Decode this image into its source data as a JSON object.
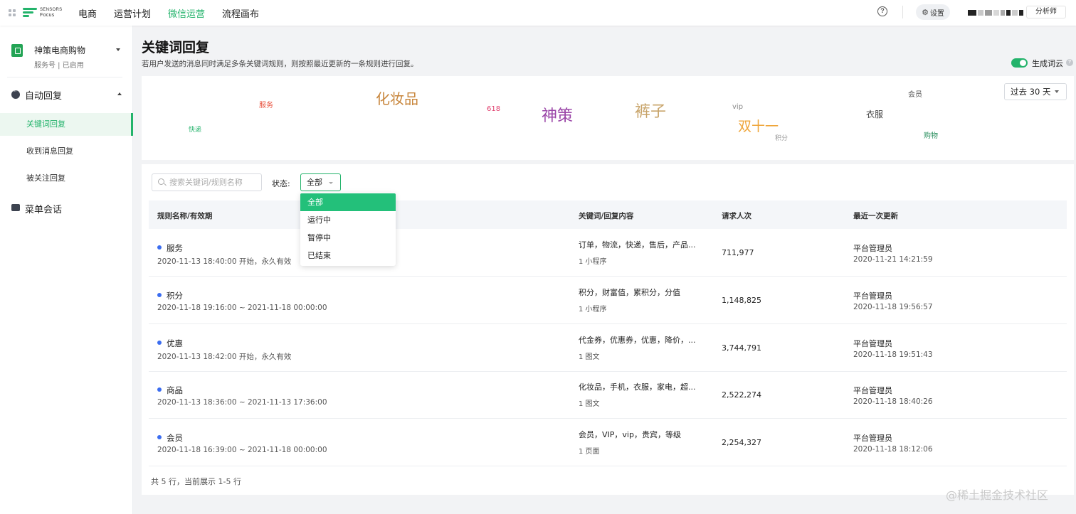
{
  "topnav": {
    "logo_line1": "SENSORS",
    "logo_line2": "Focus",
    "items": [
      {
        "label": "电商",
        "active": false
      },
      {
        "label": "运营计划",
        "active": false
      },
      {
        "label": "微信运营",
        "active": true
      },
      {
        "label": "流程画布",
        "active": false
      }
    ],
    "help": "?",
    "settings_label": "设置",
    "role_label": "分析师"
  },
  "sidebar": {
    "account_name": "神策电商购物",
    "account_sub": "服务号 | 已启用",
    "group_label": "自动回复",
    "sub_items": [
      {
        "label": "关键词回复",
        "active": true
      },
      {
        "label": "收到消息回复",
        "active": false
      },
      {
        "label": "被关注回复",
        "active": false
      }
    ],
    "menu2_label": "菜单会话"
  },
  "header": {
    "title": "关键词回复",
    "description": "若用户发送的消息同时满足多条关键词规则，则按照最近更新的一条规则进行回复。",
    "toggle_label": "生成词云",
    "toggle_on": true
  },
  "wordcloud": {
    "period": "过去 30 天",
    "words": [
      {
        "text": "服务",
        "color": "#e8503c"
      },
      {
        "text": "化妆品",
        "color": "#c8863c"
      },
      {
        "text": "618",
        "color": "#e0406e"
      },
      {
        "text": "神策",
        "color": "#9b47a8"
      },
      {
        "text": "裤子",
        "color": "#c8a46a"
      },
      {
        "text": "vip",
        "color": "#8a8a8a"
      },
      {
        "text": "双十一",
        "color": "#efa53a"
      },
      {
        "text": "积分",
        "color": "#999999"
      },
      {
        "text": "会员",
        "color": "#555555"
      },
      {
        "text": "衣服",
        "color": "#444444"
      },
      {
        "text": "购物",
        "color": "#2a8f5e"
      },
      {
        "text": "快递",
        "color": "#23b36b"
      }
    ]
  },
  "filters": {
    "search_placeholder": "搜索关键词/规则名称",
    "status_label": "状态:",
    "status_value": "全部",
    "status_options": [
      "全部",
      "运行中",
      "暂停中",
      "已结束"
    ]
  },
  "table": {
    "columns": [
      "规则名称/有效期",
      "关键词/回复内容",
      "请求人次",
      "最近一次更新"
    ],
    "rows": [
      {
        "name": "服务",
        "date": "2020-11-13 18:40:00 开始，永久有效",
        "keywords": "订单，物流，快递，售后，产品...",
        "reply_type": "1 小程序",
        "count": "711,977",
        "user": "平台管理员",
        "updated": "2020-11-21 14:21:59"
      },
      {
        "name": "积分",
        "date": "2020-11-18 19:16:00 ~ 2021-11-18 00:00:00",
        "keywords": "积分，财富值，累积分，分值",
        "reply_type": "1 小程序",
        "count": "1,148,825",
        "user": "平台管理员",
        "updated": "2020-11-18 19:56:57"
      },
      {
        "name": "优惠",
        "date": "2020-11-13 18:42:00 开始，永久有效",
        "keywords": "代金券，优惠券，优惠，降价，...",
        "reply_type": "1 图文",
        "count": "3,744,791",
        "user": "平台管理员",
        "updated": "2020-11-18 19:51:43"
      },
      {
        "name": "商品",
        "date": "2020-11-13 18:36:00 ~ 2021-11-13 17:36:00",
        "keywords": "化妆品，手机，衣服，家电，超...",
        "reply_type": "1 图文",
        "count": "2,522,274",
        "user": "平台管理员",
        "updated": "2020-11-18 18:40:26"
      },
      {
        "name": "会员",
        "date": "2020-11-18 16:39:00 ~ 2021-11-18 00:00:00",
        "keywords": "会员，VIP，vip，贵宾，等级",
        "reply_type": "1 页面",
        "count": "2,254,327",
        "user": "平台管理员",
        "updated": "2020-11-18 18:12:06"
      }
    ],
    "footer": "共 5 行，当前展示 1-5 行"
  },
  "watermark": "@稀土掘金技术社区"
}
